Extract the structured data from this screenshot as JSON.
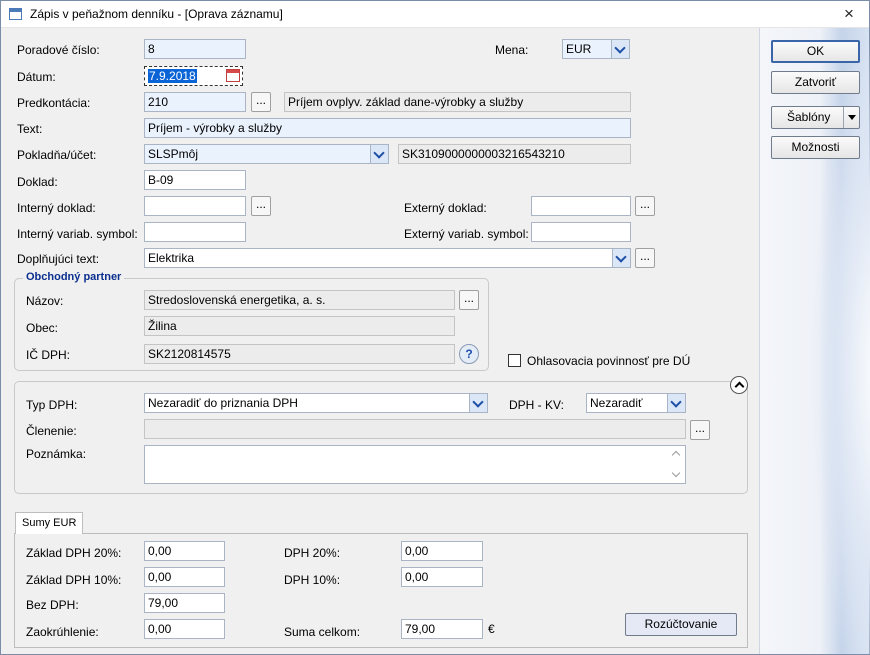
{
  "window": {
    "title": "Zápis v peňažnom denníku - [Oprava záznamu]"
  },
  "fields": {
    "poradove_cislo": {
      "label": "Poradové číslo:",
      "value": "8"
    },
    "mena": {
      "label": "Mena:",
      "value": "EUR"
    },
    "datum": {
      "label": "Dátum:",
      "value": "7.9.2018"
    },
    "predkontacia": {
      "label": "Predkontácia:",
      "value": "210",
      "description": "Príjem ovplyv. základ dane-výrobky a služby"
    },
    "text": {
      "label": "Text:",
      "value": "Príjem - výrobky a služby"
    },
    "pokladna": {
      "label": "Pokladňa/účet:",
      "value": "SLSPmôj",
      "iban": "SK3109000000003216543210"
    },
    "doklad": {
      "label": "Doklad:",
      "value": "B-09"
    },
    "interny_doklad": {
      "label": "Interný doklad:",
      "value": ""
    },
    "externy_doklad": {
      "label": "Externý doklad:",
      "value": ""
    },
    "interny_vs": {
      "label": "Interný variab. symbol:",
      "value": ""
    },
    "externy_vs": {
      "label": "Externý variab. symbol:",
      "value": ""
    },
    "doplnujuci_text": {
      "label": "Doplňujúci text:",
      "value": "Elektrika"
    }
  },
  "partner": {
    "group_title": "Obchodný partner",
    "nazov_label": "Názov:",
    "nazov": "Stredoslovenská energetika, a. s.",
    "obec_label": "Obec:",
    "obec": "Žilina",
    "icdph_label": "IČ DPH:",
    "icdph": "SK2120814575"
  },
  "ohlasovacia": {
    "label": "Ohlasovacia povinnosť pre DÚ",
    "checked": false
  },
  "dph": {
    "typ_label": "Typ DPH:",
    "typ_value": "Nezaradiť do priznania DPH",
    "kv_label": "DPH - KV:",
    "kv_value": "Nezaradiť",
    "clenenie_label": "Členenie:",
    "clenenie_value": "",
    "poznamka_label": "Poznámka:",
    "poznamka_value": ""
  },
  "sums": {
    "tab_label": "Sumy EUR",
    "zaklad20_label": "Základ DPH 20%:",
    "zaklad20": "0,00",
    "zaklad10_label": "Základ DPH 10%:",
    "zaklad10": "0,00",
    "bez_dph_label": "Bez DPH:",
    "bez_dph": "79,00",
    "zaokruhlenie_label": "Zaokrúhlenie:",
    "zaokruhlenie": "0,00",
    "dph20_label": "DPH 20%:",
    "dph20": "0,00",
    "dph10_label": "DPH 10%:",
    "dph10": "0,00",
    "suma_label": "Suma celkom:",
    "suma": "79,00",
    "currency_symbol": "€",
    "rozuctovanie_label": "Rozúčtovanie"
  },
  "buttons": {
    "ok": "OK",
    "zatvorit": "Zatvoriť",
    "sablony": "Šablóny",
    "moznosti": "Možnosti",
    "dots": "..."
  },
  "icons": {
    "close": "×",
    "help": "?"
  }
}
